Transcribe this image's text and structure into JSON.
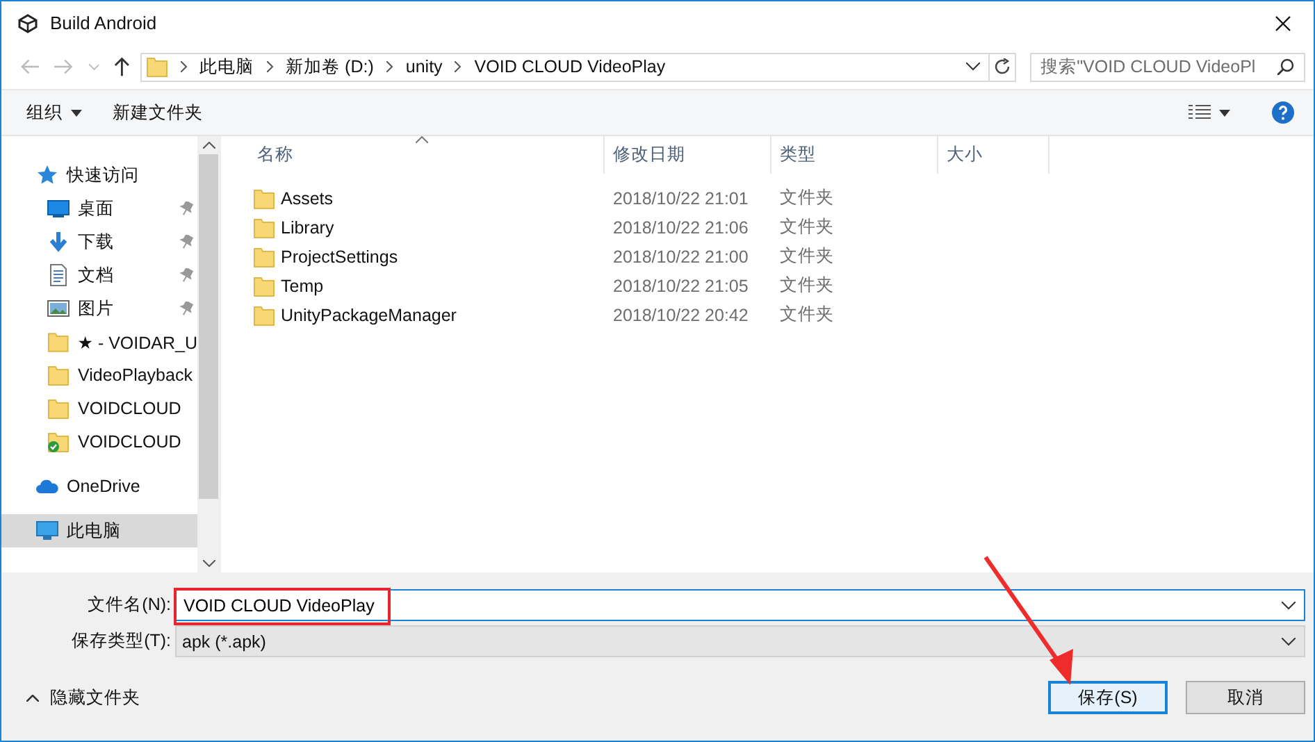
{
  "window": {
    "title": "Build Android"
  },
  "address": {
    "crumbs": [
      "此电脑",
      "新加卷 (D:)",
      "unity",
      "VOID CLOUD VideoPlay"
    ]
  },
  "search": {
    "placeholder": "搜索\"VOID CLOUD VideoPl"
  },
  "toolbar": {
    "organize": "组织",
    "new_folder": "新建文件夹"
  },
  "sidebar": {
    "items": [
      {
        "kind": "star",
        "label": "快速访问",
        "pinned": false,
        "selected": false
      },
      {
        "kind": "desktop",
        "label": "桌面",
        "pinned": true,
        "selected": false
      },
      {
        "kind": "download",
        "label": "下载",
        "pinned": true,
        "selected": false
      },
      {
        "kind": "document",
        "label": "文档",
        "pinned": true,
        "selected": false
      },
      {
        "kind": "picture",
        "label": "图片",
        "pinned": true,
        "selected": false
      },
      {
        "kind": "folder",
        "label": "★ - VOIDAR_U",
        "pinned": false,
        "selected": false
      },
      {
        "kind": "folder",
        "label": "VideoPlayback",
        "pinned": false,
        "selected": false
      },
      {
        "kind": "folder",
        "label": "VOIDCLOUD",
        "pinned": false,
        "selected": false
      },
      {
        "kind": "synced",
        "label": "VOIDCLOUD",
        "pinned": false,
        "selected": false
      },
      {
        "kind": "cloud",
        "label": "OneDrive",
        "pinned": false,
        "selected": false
      },
      {
        "kind": "computer",
        "label": "此电脑",
        "pinned": false,
        "selected": true
      }
    ]
  },
  "table": {
    "columns": [
      "名称",
      "修改日期",
      "类型",
      "大小"
    ],
    "rows": [
      {
        "name": "Assets",
        "modified": "2018/10/22 21:01",
        "type": "文件夹"
      },
      {
        "name": "Library",
        "modified": "2018/10/22 21:06",
        "type": "文件夹"
      },
      {
        "name": "ProjectSettings",
        "modified": "2018/10/22 21:00",
        "type": "文件夹"
      },
      {
        "name": "Temp",
        "modified": "2018/10/22 21:05",
        "type": "文件夹"
      },
      {
        "name": "UnityPackageManager",
        "modified": "2018/10/22 20:42",
        "type": "文件夹"
      }
    ]
  },
  "filename": {
    "label": "文件名(N):",
    "value": "VOID CLOUD VideoPlay",
    "highlighted": true
  },
  "filetype": {
    "label": "保存类型(T):",
    "value": "apk (*.apk)"
  },
  "hide_folders": "隐藏文件夹",
  "buttons": [
    {
      "label": "保存(S)",
      "default": true
    },
    {
      "label": "取消",
      "default": false
    }
  ],
  "annotation_arrow": true
}
